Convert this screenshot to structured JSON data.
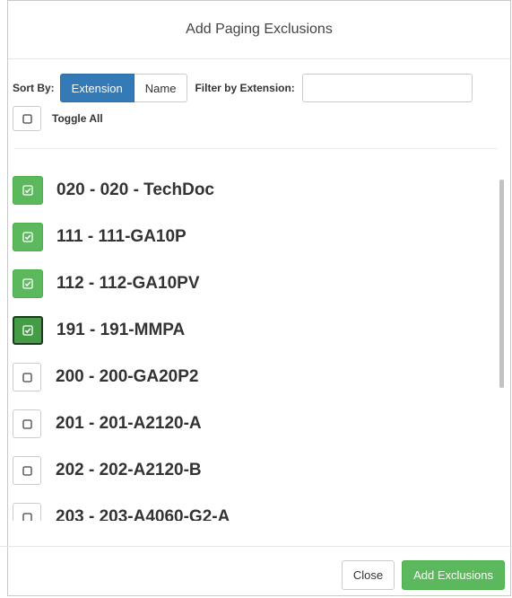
{
  "modal": {
    "title": "Add Paging Exclusions"
  },
  "controls": {
    "sort_label": "Sort By:",
    "sort_options": [
      "Extension",
      "Name"
    ],
    "sort_selected": "Extension",
    "filter_label": "Filter by Extension:",
    "filter_value": "",
    "toggle_all_label": "Toggle All",
    "toggle_all_checked": false
  },
  "list": {
    "items": [
      {
        "label": "020 - 020 - TechDoc",
        "checked": true,
        "focused": false
      },
      {
        "label": "111 - 111-GA10P",
        "checked": true,
        "focused": false
      },
      {
        "label": "112 - 112-GA10PV",
        "checked": true,
        "focused": false
      },
      {
        "label": "191 - 191-MMPA",
        "checked": true,
        "focused": true
      },
      {
        "label": "200 - 200-GA20P2",
        "checked": false,
        "focused": false
      },
      {
        "label": "201 - 201-A2120-A",
        "checked": false,
        "focused": false
      },
      {
        "label": "202 - 202-A2120-B",
        "checked": false,
        "focused": false
      },
      {
        "label": "203 - 203-A4060-G2-A",
        "checked": false,
        "focused": false
      }
    ]
  },
  "footer": {
    "close_label": "Close",
    "add_label": "Add Exclusions"
  },
  "colors": {
    "primary": "#337ab7",
    "success": "#5cb85c",
    "success_dark": "#449d44"
  },
  "icons": {
    "checked": "check-square-icon",
    "unchecked": "square-icon"
  }
}
